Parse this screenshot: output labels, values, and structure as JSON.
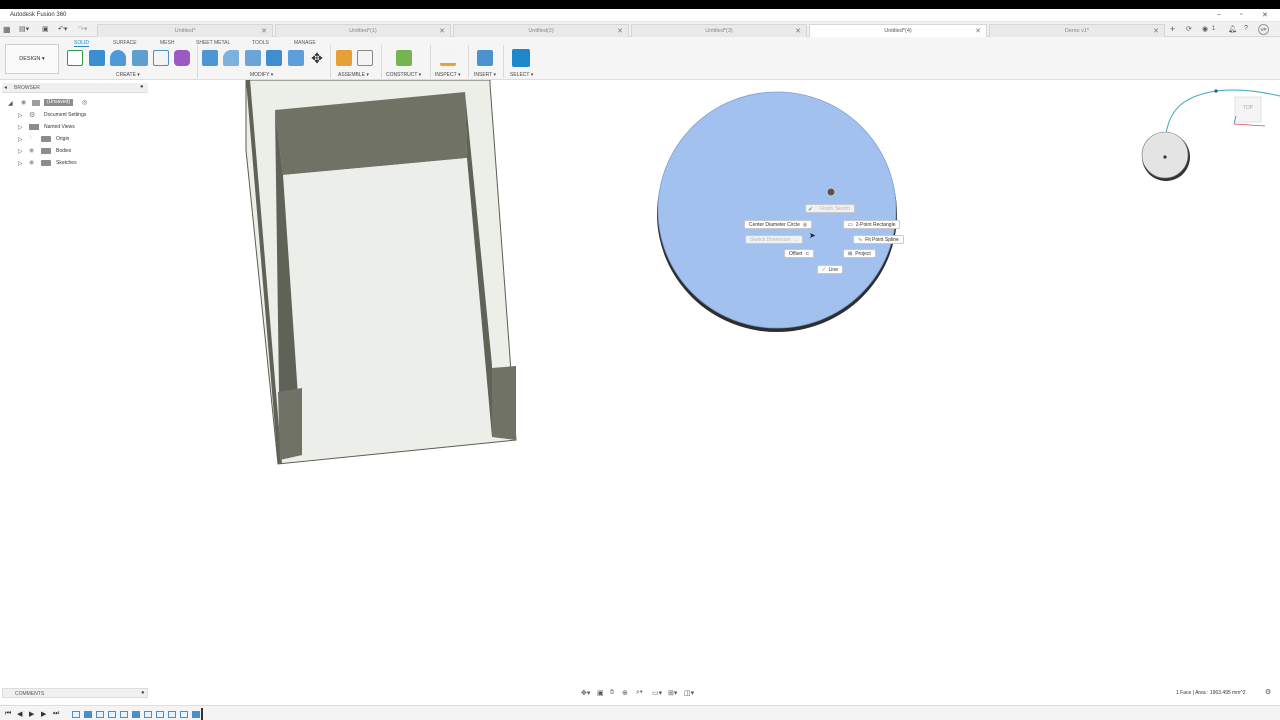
{
  "app": {
    "title": "Autodesk Fusion 360"
  },
  "tabs": [
    {
      "label": "Untitled*",
      "active": false
    },
    {
      "label": "Untitled*(1)",
      "active": false
    },
    {
      "label": "Untitled(2)",
      "active": false
    },
    {
      "label": "Untitled*(3)",
      "active": false
    },
    {
      "label": "Untitled*(4)",
      "active": true
    },
    {
      "label": "Demo v1*",
      "active": false
    }
  ],
  "header_right": {
    "job_count": "1",
    "user_initials": "VP"
  },
  "workspace": {
    "label": "DESIGN ▾"
  },
  "ribbon_tabs": [
    "SOLID",
    "SURFACE",
    "MESH",
    "SHEET METAL",
    "TOOLS",
    "MANAGE"
  ],
  "tool_groups": [
    "CREATE ▾",
    "MODIFY ▾",
    "ASSEMBLE ▾",
    "CONSTRUCT ▾",
    "INSPECT ▾",
    "INSERT ▾",
    "SELECT ▾"
  ],
  "browser": {
    "header": "BROWSER",
    "root": "(Unsaved)",
    "items": [
      "Document Settings",
      "Named Views",
      "Origin",
      "Bodies",
      "Sketches"
    ]
  },
  "comments": {
    "label": "COMMENTS"
  },
  "viewcube": {
    "face": "TOP"
  },
  "marking_menu": {
    "finish_sketch": "Finish Sketch",
    "center_circle": "Center Diameter Circle",
    "two_point_rect": "2-Point Rectangle",
    "sketch_dimension": "Sketch Dimension",
    "fit_spline": "Fit Point Spline",
    "offset": "Offset",
    "project": "Project",
    "line": "Line"
  },
  "status": {
    "selection": "1 Face | Area : 1963.495 mm^2"
  },
  "colors": {
    "accent": "#1c87c9",
    "face_highlight": "#a3c1ef",
    "body_dark": "#6f7265",
    "body_light": "#eceee8"
  }
}
